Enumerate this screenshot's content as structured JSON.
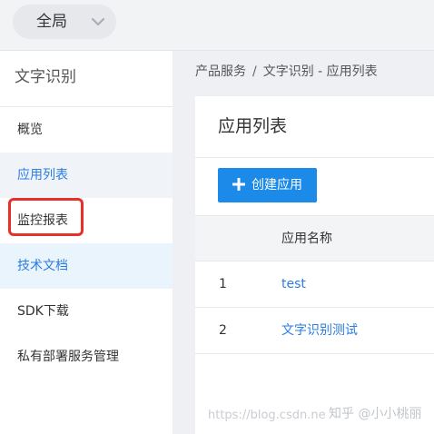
{
  "topbar": {
    "region_label": "全局",
    "region_icon": "chevron-down-icon"
  },
  "sidebar": {
    "title": "文字识别",
    "items": [
      {
        "label": "概览",
        "state": "normal"
      },
      {
        "label": "应用列表",
        "state": "active"
      },
      {
        "label": "监控报表",
        "state": "normal"
      },
      {
        "label": "技术文档",
        "state": "hover-highlighted"
      },
      {
        "label": "SDK下载",
        "state": "normal"
      },
      {
        "label": "私有部署服务管理",
        "state": "normal"
      }
    ],
    "highlight_color": "#e8302a"
  },
  "breadcrumb": {
    "root": "产品服务",
    "separator": "/",
    "current": "文字识别 - 应用列表"
  },
  "main": {
    "title": "应用列表",
    "create_button": {
      "icon": "plus-icon",
      "label": "创建应用",
      "color": "#1b8ae8"
    },
    "table": {
      "columns": [
        "",
        "应用名称"
      ],
      "rows": [
        {
          "index": "1",
          "name": "test"
        },
        {
          "index": "2",
          "name": "文字识别测试"
        }
      ]
    }
  },
  "watermark": {
    "left_text": "https://blog.csdn.ne",
    "right_text": "知乎 @小小桃丽"
  },
  "colors": {
    "accent": "#2b7de0",
    "primary_button": "#1b8ae8",
    "content_bg": "#eef0f3",
    "highlight": "#e8302a"
  }
}
